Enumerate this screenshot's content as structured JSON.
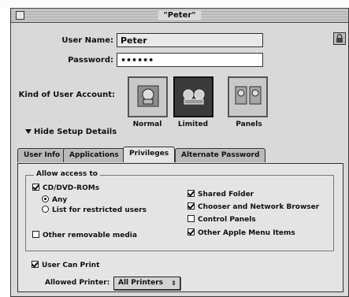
{
  "window": {
    "title": "\"Peter\""
  },
  "user": {
    "name_label": "User Name:",
    "name_value": "Peter",
    "password_label": "Password:",
    "password_value": "••••••",
    "kind_label": "Kind of User Account:"
  },
  "account_kinds": [
    {
      "label": "Normal",
      "selected": false,
      "icon": "normal-user-icon"
    },
    {
      "label": "Limited",
      "selected": true,
      "icon": "limited-user-icon"
    },
    {
      "label": "Panels",
      "selected": false,
      "icon": "panels-user-icon"
    }
  ],
  "disclosure": {
    "label": "Hide Setup Details",
    "expanded": true
  },
  "tabs": [
    {
      "label": "User Info",
      "active": false
    },
    {
      "label": "Applications",
      "active": false
    },
    {
      "label": "Privileges",
      "active": true
    },
    {
      "label": "Alternate Password",
      "active": false
    }
  ],
  "privileges": {
    "group_title": "Allow access to",
    "cd_dvd": {
      "label": "CD/DVD-ROMs",
      "checked": true
    },
    "any": {
      "label": "Any",
      "checked": true
    },
    "list_only": {
      "label": "List for restricted users",
      "checked": false
    },
    "removable": {
      "label": "Other removable media",
      "checked": false
    },
    "shared_folder": {
      "label": "Shared Folder",
      "checked": true
    },
    "chooser": {
      "label": "Chooser and Network Browser",
      "checked": true
    },
    "control_panels": {
      "label": "Control Panels",
      "checked": false
    },
    "apple_menu": {
      "label": "Other Apple Menu Items",
      "checked": true
    },
    "can_print": {
      "label": "User Can Print",
      "checked": true
    },
    "printer_label": "Allowed Printer:",
    "printer_value": "All Printers"
  },
  "colors": {
    "window": "#d9d9d9",
    "panel": "#e4e4e4",
    "selected_kind": "#3a3a3a"
  }
}
